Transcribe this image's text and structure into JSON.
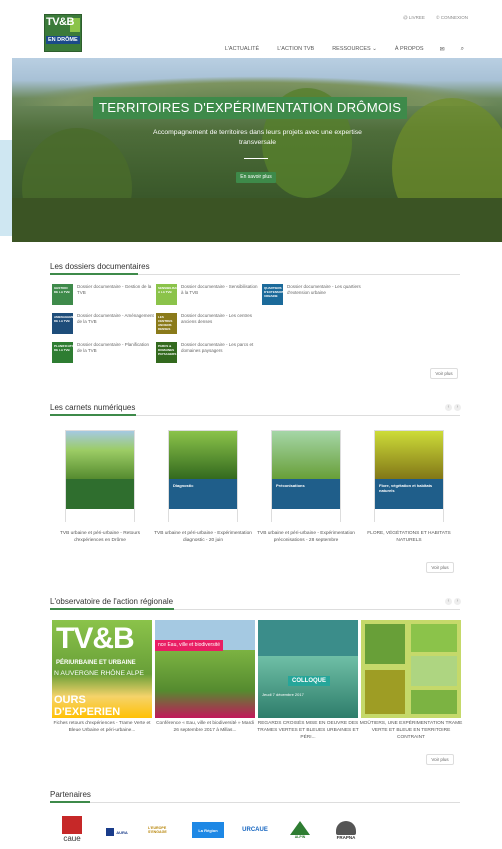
{
  "header": {
    "logo_line1": "TV&B",
    "logo_line2": "EN DRÔME",
    "top_links": [
      "@ LIVREE",
      "© CONNEXION"
    ],
    "nav": [
      "L'ACTUALITÉ",
      "L'ACTION TVB",
      "RESSOURCES ⌄",
      "À PROPOS"
    ],
    "nav_icons": [
      "envelope-icon",
      "search-icon"
    ]
  },
  "hero": {
    "title": "TERRITOIRES D'EXPÉRIMENTATION DRÔMOIS",
    "subtitle": "Accompagnement de territoires dans leurs projets avec une expertise transversale",
    "button": "En savoir plus"
  },
  "dossiers": {
    "title": "Les dossiers documentaires",
    "items": [
      {
        "label": "Dossier documentaire - Gestion de la TVB",
        "thumb": "GESTION DE LA TVB",
        "color": "#3e8a4a"
      },
      {
        "label": "Dossier documentaire - Sensibilisation à la TVB",
        "thumb": "SENSIBILISATION A LA TVB",
        "color": "#8bc34a"
      },
      {
        "label": "Dossier documentaire - Les quartiers d'extension urbaine",
        "thumb": "QUARTIERS D'EXTENSION URBAINE",
        "color": "#1b6a9a"
      },
      {
        "label": "Dossier documentaire - Aménagement de la TVB",
        "thumb": "AMENAGEMENT DE LA TVB",
        "color": "#1e4d7a"
      },
      {
        "label": "Dossier documentaire - Les centres anciens denses",
        "thumb": "LES CENTRES ANCIENS DENSES",
        "color": "#8a7a1a"
      },
      {
        "label": "Dossier documentaire - Planification de la TVB",
        "thumb": "PLANIFICATION DE LA TVB",
        "color": "#2e7d32"
      },
      {
        "label": "Dossier documentaire - Les parcs et domaines paysagers",
        "thumb": "PARCS & DOMAINES PAYSAGERS",
        "color": "#33691e"
      }
    ],
    "more": "Voir plus"
  },
  "carnets": {
    "title": "Les carnets numériques",
    "items": [
      {
        "caption": "TVB urbaine et péri-urbaine - Retours d'expériences en Drôme",
        "band": "",
        "color": "#2f6e2e"
      },
      {
        "caption": "TVB urbaine et péri-urbaine - Expérimentation diagnostic - 20 juin",
        "band": "Diagnostic",
        "color": "#1f5e8a"
      },
      {
        "caption": "TVB urbaine et péri-urbaine - Expérimentation préconisations - 28 septembre",
        "band": "Préconisations",
        "color": "#1f5e8a"
      },
      {
        "caption": "FLORE, VÉGÉTATIONS ET HABITATS NATURELS",
        "band": "Flore, végétation et habitats naturels",
        "color": "#1f5e8a"
      }
    ],
    "more": "Voir plus"
  },
  "observatoire": {
    "title": "L'observatoire de l'action régionale",
    "items": [
      {
        "caption": "Fiches retours d'expériences - Trame Verte et Bleue Urbaine et péri-urbaine...",
        "big": "TV&B",
        "line2": "PÉRIURBAINE ET URBAINE",
        "line3": "N AUVERGNE RHÔNE ALPE",
        "line4": "OURS D'EXPERIEN"
      },
      {
        "caption": "Conférence « Eau, ville et biodiversité » Mardi 26 septembre 2017 à Millas...",
        "banner": "nce Eau, ville et biodiversité"
      },
      {
        "caption": "REGARDS CROISÉS MISE EN OEUVRE DES TRAMES VERTES ET BLEUES URBAINES ET PÉRI...",
        "banner": "COLLOQUE",
        "date": "Jeudi 7 décembre 2017"
      },
      {
        "caption": "MOÛTIERS, UNE EXPÉRIMENTATION TRAME VERTE ET BLEUE EN TERRITOIRE CONTRAINT",
        "banner": ""
      }
    ],
    "more": "Voir plus"
  },
  "partenaires": {
    "title": "Partenaires",
    "items": [
      "caue",
      "AURA",
      "L'EUROPE S'ENGAGE",
      "La Région",
      "URCAUE",
      "ALPIN",
      "FRAPNA"
    ]
  }
}
